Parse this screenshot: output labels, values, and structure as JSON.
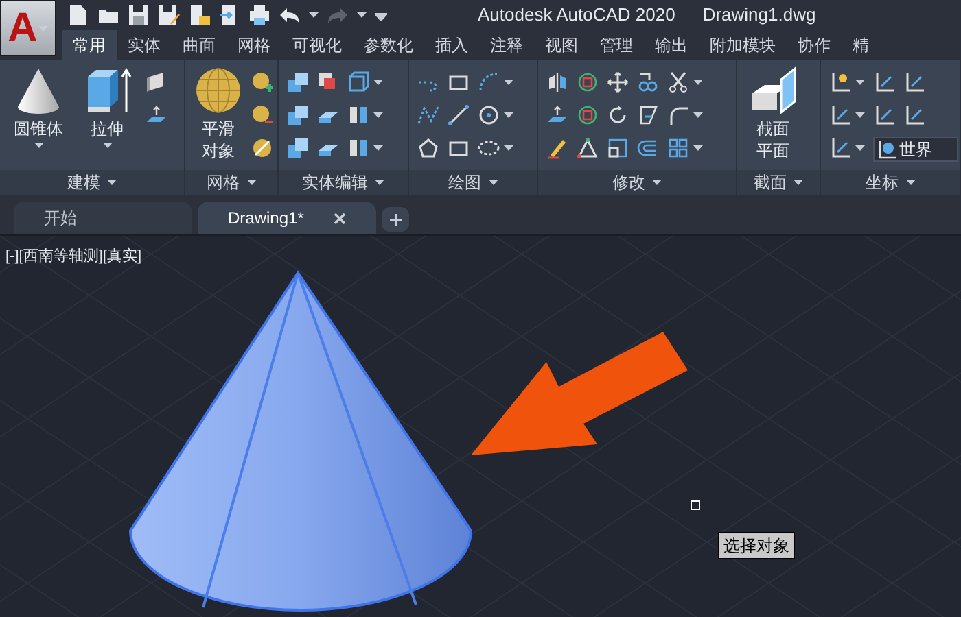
{
  "app_menu": {
    "letter": "A"
  },
  "window": {
    "title": "Autodesk AutoCAD 2020",
    "document": "Drawing1.dwg"
  },
  "ribbon_tabs": [
    {
      "label": "常用",
      "selected": true
    },
    {
      "label": "实体",
      "selected": false
    },
    {
      "label": "曲面",
      "selected": false
    },
    {
      "label": "网格",
      "selected": false
    },
    {
      "label": "可视化",
      "selected": false
    },
    {
      "label": "参数化",
      "selected": false
    },
    {
      "label": "插入",
      "selected": false
    },
    {
      "label": "注释",
      "selected": false
    },
    {
      "label": "视图",
      "selected": false
    },
    {
      "label": "管理",
      "selected": false
    },
    {
      "label": "输出",
      "selected": false
    },
    {
      "label": "附加模块",
      "selected": false
    },
    {
      "label": "协作",
      "selected": false
    },
    {
      "label": "精",
      "selected": false
    }
  ],
  "ribbon_panels": [
    {
      "title": "建模",
      "buttons": [
        "圆锥体",
        "拉伸"
      ]
    },
    {
      "title": "网格",
      "buttons": [
        "平滑对象"
      ]
    },
    {
      "title": "实体编辑"
    },
    {
      "title": "绘图"
    },
    {
      "title": "修改"
    },
    {
      "title": "截面",
      "buttons": [
        "截面平面"
      ]
    },
    {
      "title": "坐标",
      "view_field": "世界"
    }
  ],
  "document_tabs": [
    {
      "label": "开始",
      "selected": false,
      "closable": false
    },
    {
      "label": "Drawing1*",
      "selected": true,
      "closable": true
    }
  ],
  "viewport": {
    "label": "[-][西南等轴测][真实]",
    "tooltip": "选择对象"
  }
}
